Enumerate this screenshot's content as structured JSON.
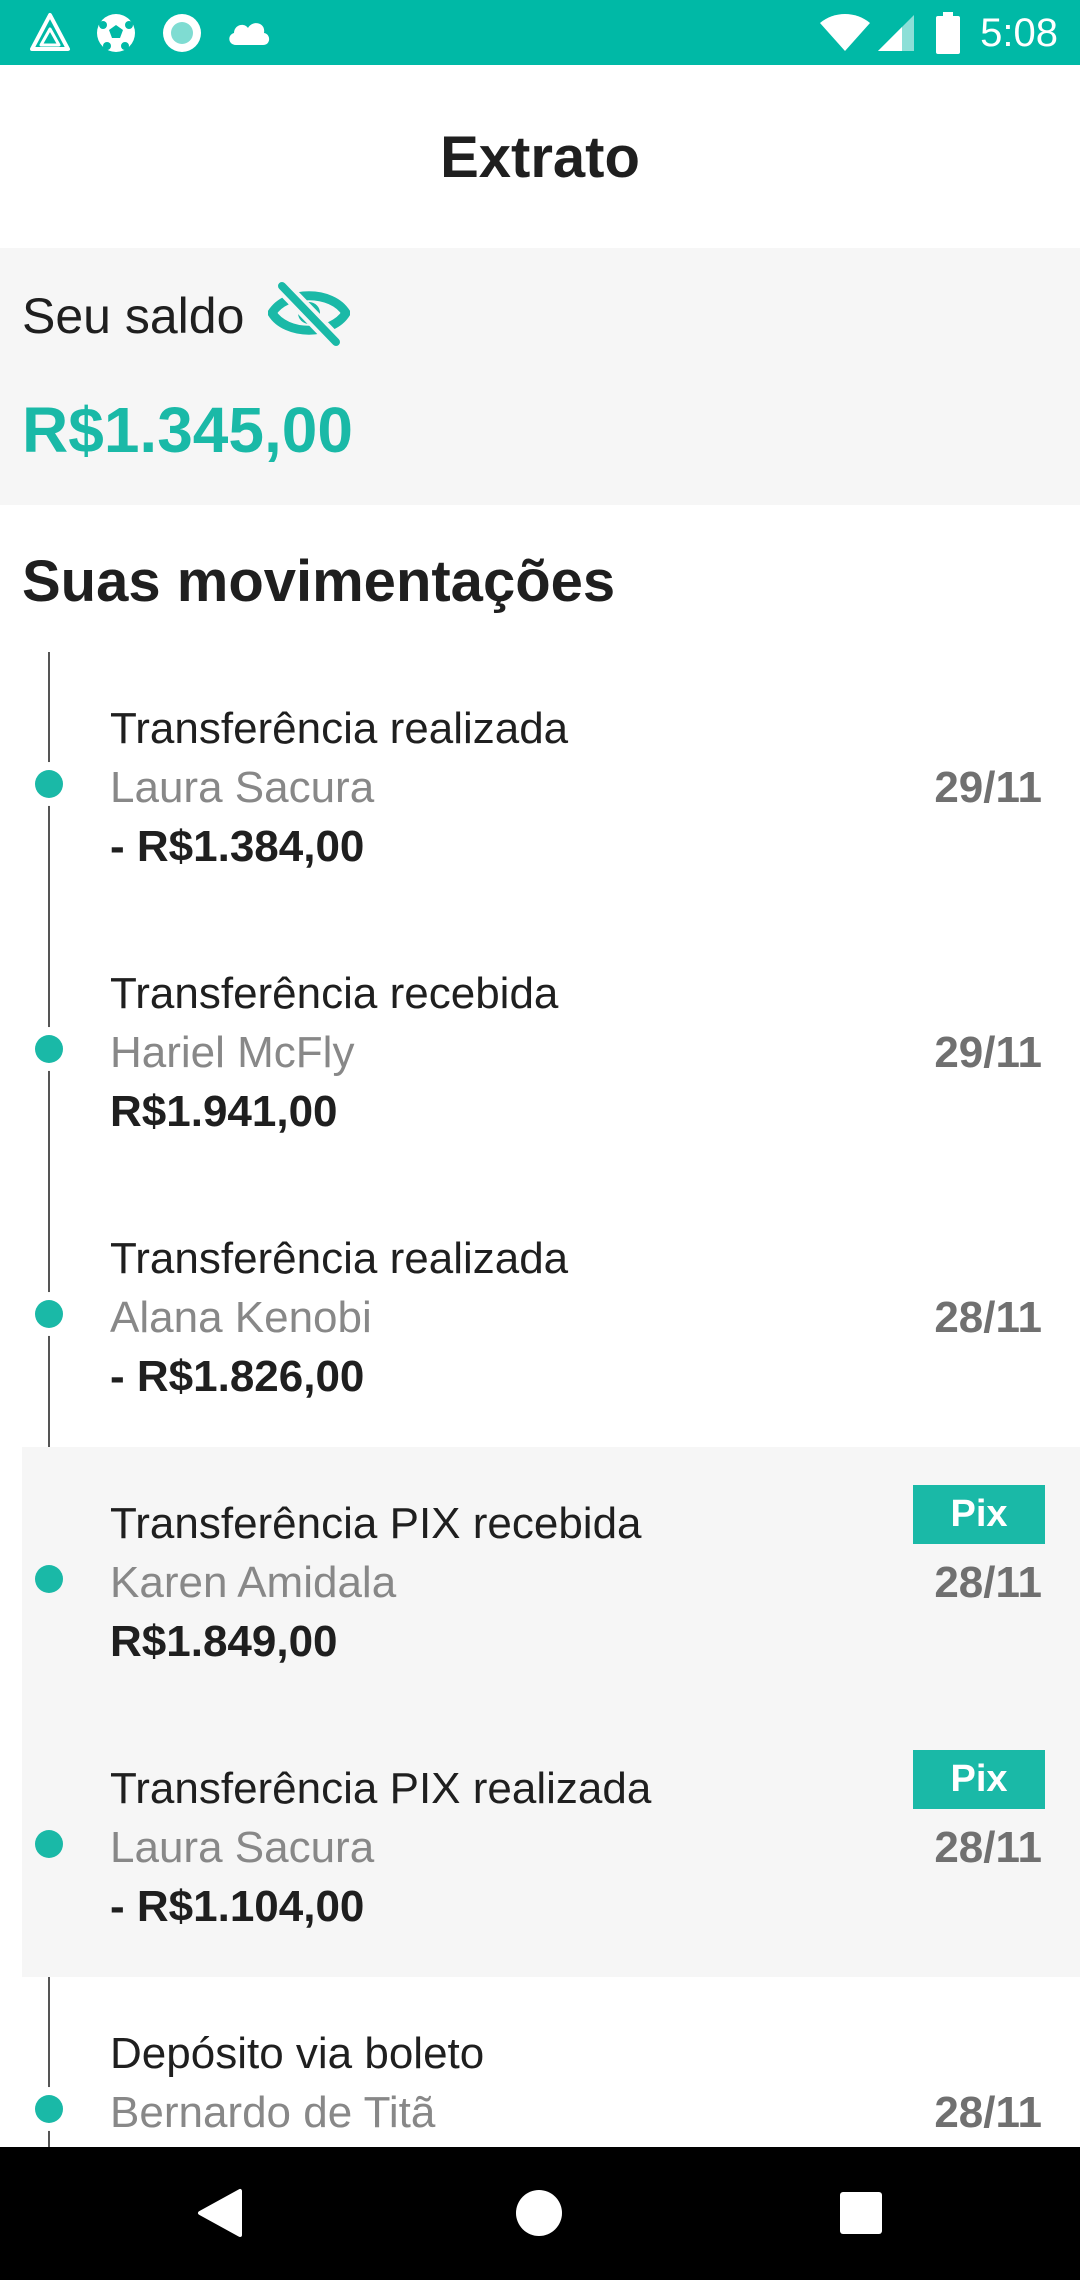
{
  "status_bar": {
    "time": "5:08",
    "icons_left": [
      "app-notification-icon",
      "soccer-ball-icon",
      "circle-app-icon",
      "cloud-icon"
    ],
    "icons_right": [
      "wifi-icon",
      "signal-icon",
      "battery-icon"
    ]
  },
  "header": {
    "title": "Extrato"
  },
  "balance": {
    "label": "Seu saldo",
    "value": "R$1.345,00",
    "toggle_icon": "eye-off-icon"
  },
  "transactions": {
    "section_title": "Suas movimentações",
    "badge_label": "Pix",
    "items": [
      {
        "title": "Transferência realizada",
        "name": "Laura Sacura",
        "amount": "- R$1.384,00",
        "date": "29/11",
        "pix": false
      },
      {
        "title": "Transferência recebida",
        "name": "Hariel McFly",
        "amount": "R$1.941,00",
        "date": "29/11",
        "pix": false
      },
      {
        "title": "Transferência realizada",
        "name": "Alana Kenobi",
        "amount": "- R$1.826,00",
        "date": "28/11",
        "pix": false
      },
      {
        "title": "Transferência PIX recebida",
        "name": "Karen Amidala",
        "amount": "R$1.849,00",
        "date": "28/11",
        "pix": true
      },
      {
        "title": "Transferência PIX realizada",
        "name": "Laura Sacura",
        "amount": "- R$1.104,00",
        "date": "28/11",
        "pix": true
      },
      {
        "title": "Depósito via boleto",
        "name": "Bernardo de Titã",
        "amount": "",
        "date": "28/11",
        "pix": false
      }
    ]
  },
  "nav": {
    "buttons": [
      "back-icon",
      "home-icon",
      "recents-icon"
    ]
  },
  "colors": {
    "status_bar": "#00b9a6",
    "accent": "#1ab9a7",
    "card_bg": "#f6f6f6",
    "nav_bar": "#000000"
  }
}
